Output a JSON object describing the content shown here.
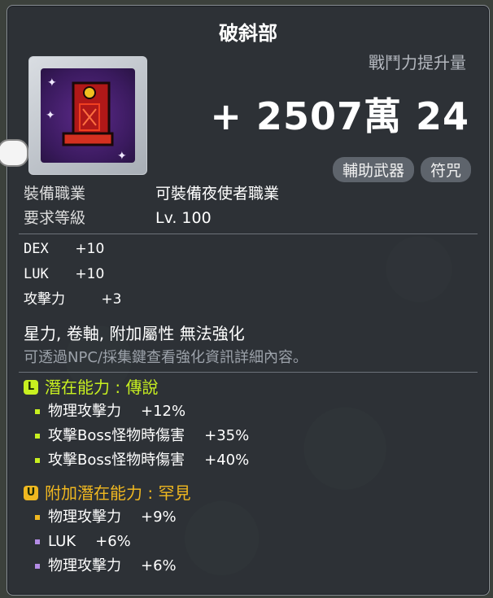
{
  "colors": {
    "legendary": "#c8f020",
    "unique": "#f0b820",
    "legendary_bullet": "#c8f020",
    "unique_bullet_gold": "#f0b820",
    "unique_bullet_purple": "#b48ce6"
  },
  "item": {
    "name": "破斜部",
    "icon": "red-talisman-icon"
  },
  "power": {
    "label": "戰鬥力提升量",
    "value": "+ 2507萬 24"
  },
  "badges": [
    "輔助武器",
    "符咒"
  ],
  "requirements": [
    {
      "key": "裝備職業",
      "value": "可裝備夜使者職業"
    },
    {
      "key": "要求等級",
      "value": "Lv. 100"
    }
  ],
  "stats": [
    {
      "name": "DEX",
      "value": "+10"
    },
    {
      "name": "LUK",
      "value": "+10"
    },
    {
      "name": "攻擊力",
      "value": "+3"
    }
  ],
  "notes": {
    "main": "星力, 卷軸, 附加屬性 無法強化",
    "sub": "可透過NPC/採集鍵查看強化資訊詳細內容。"
  },
  "potential": {
    "badge": "L",
    "title": "潛在能力 : 傳說",
    "lines": [
      {
        "text": "物理攻擊力",
        "value": "+12%"
      },
      {
        "text": "攻擊Boss怪物時傷害",
        "value": "+35%"
      },
      {
        "text": "攻擊Boss怪物時傷害",
        "value": "+40%"
      }
    ]
  },
  "additional": {
    "badge": "U",
    "title": "附加潛在能力 : 罕見",
    "lines": [
      {
        "text": "物理攻擊力",
        "value": "+9%",
        "bullet": "gold"
      },
      {
        "text": "LUK",
        "value": "+6%",
        "bullet": "purple"
      },
      {
        "text": "物理攻擊力",
        "value": "+6%",
        "bullet": "purple"
      }
    ]
  }
}
